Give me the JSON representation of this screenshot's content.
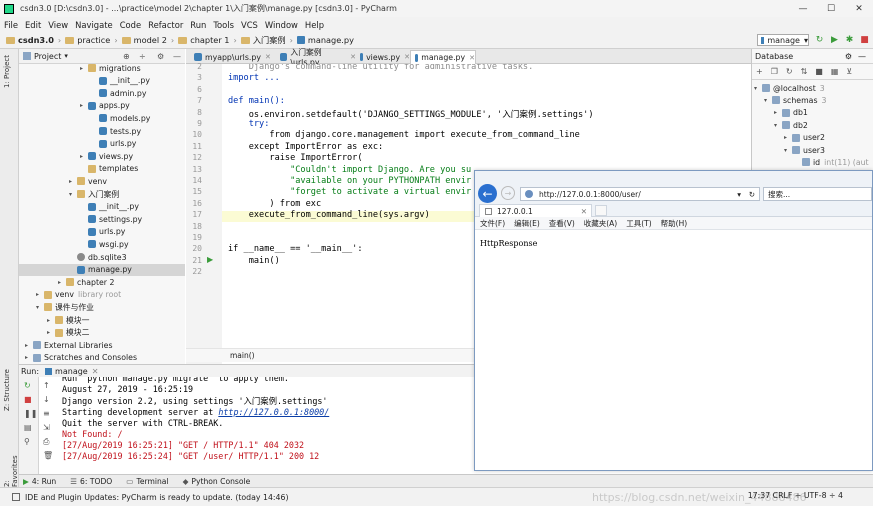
{
  "window": {
    "title": "csdn3.0 [D:\\csdn3.0] - ...\\practice\\model 2\\chapter 1\\入门案例\\manage.py [csdn3.0] - PyCharm"
  },
  "menu": [
    "File",
    "Edit",
    "View",
    "Navigate",
    "Code",
    "Refactor",
    "Run",
    "Tools",
    "VCS",
    "Window",
    "Help"
  ],
  "breadcrumb": [
    "csdn3.0",
    "practice",
    "model 2",
    "chapter 1",
    "入门案例",
    "manage.py"
  ],
  "run_config": "manage",
  "sidebar_tabs": {
    "project": "1: Project",
    "structure": "Z: Structure",
    "favorites": "2: Favorites"
  },
  "project_panel": {
    "title": "Project"
  },
  "tree": [
    {
      "label": "migrations",
      "indent": 4,
      "icon": "fold",
      "arrow": "▸"
    },
    {
      "label": "__init__.py",
      "indent": 5,
      "icon": "py",
      "arrow": ""
    },
    {
      "label": "admin.py",
      "indent": 5,
      "icon": "py",
      "arrow": ""
    },
    {
      "label": "apps.py",
      "indent": 4,
      "icon": "py",
      "arrow": "▸"
    },
    {
      "label": "models.py",
      "indent": 5,
      "icon": "py",
      "arrow": ""
    },
    {
      "label": "tests.py",
      "indent": 5,
      "icon": "py",
      "arrow": ""
    },
    {
      "label": "urls.py",
      "indent": 5,
      "icon": "py",
      "arrow": ""
    },
    {
      "label": "views.py",
      "indent": 4,
      "icon": "py",
      "arrow": "▸"
    },
    {
      "label": "templates",
      "indent": 4,
      "icon": "fold",
      "arrow": ""
    },
    {
      "label": "venv",
      "indent": 3,
      "icon": "fold",
      "arrow": "▸"
    },
    {
      "label": "入门案例",
      "indent": 3,
      "icon": "fold",
      "arrow": "▾"
    },
    {
      "label": "__init__.py",
      "indent": 4,
      "icon": "py",
      "arrow": ""
    },
    {
      "label": "settings.py",
      "indent": 4,
      "icon": "py",
      "arrow": ""
    },
    {
      "label": "urls.py",
      "indent": 4,
      "icon": "py",
      "arrow": ""
    },
    {
      "label": "wsgi.py",
      "indent": 4,
      "icon": "py",
      "arrow": ""
    },
    {
      "label": "db.sqlite3",
      "indent": 3,
      "icon": "db",
      "arrow": ""
    },
    {
      "label": "manage.py",
      "indent": 3,
      "icon": "py",
      "arrow": "",
      "selected": true
    },
    {
      "label": "chapter 2",
      "indent": 2,
      "icon": "fold",
      "arrow": "▸"
    },
    {
      "label": "venv",
      "suffix": "library root",
      "indent": 0,
      "icon": "fold",
      "arrow": "▸"
    },
    {
      "label": "课件与作业",
      "indent": 0,
      "icon": "fold",
      "arrow": "▾"
    },
    {
      "label": "模块一",
      "indent": 1,
      "icon": "fold",
      "arrow": "▸"
    },
    {
      "label": "模块二",
      "indent": 1,
      "icon": "fold",
      "arrow": "▸"
    },
    {
      "label": "External Libraries",
      "indent": -1,
      "icon": "foldb",
      "arrow": "▸"
    },
    {
      "label": "Scratches and Consoles",
      "indent": -1,
      "icon": "foldb",
      "arrow": "▸"
    }
  ],
  "editor_tabs": [
    {
      "label": "myapp\\urls.py",
      "active": false
    },
    {
      "label": "入门案例\\urls.py",
      "active": false
    },
    {
      "label": "views.py",
      "active": false
    },
    {
      "label": "manage.py",
      "active": true
    }
  ],
  "code_lines": [
    {
      "n": "2",
      "text": "    Django's command-line utility for administrative tasks.",
      "cls": "cm"
    },
    {
      "n": "3",
      "text": "import ...",
      "cls": "kw"
    },
    {
      "n": "6",
      "text": "",
      "cls": ""
    },
    {
      "n": "7",
      "text": "def main():",
      "cls": "kw"
    },
    {
      "n": "8",
      "text": "    os.environ.setdefault('DJANGO_SETTINGS_MODULE', '入门案例.settings')",
      "cls": ""
    },
    {
      "n": "9",
      "text": "    try:",
      "cls": "kw"
    },
    {
      "n": "10",
      "text": "        from django.core.management import execute_from_command_line",
      "cls": ""
    },
    {
      "n": "11",
      "text": "    except ImportError as exc:",
      "cls": ""
    },
    {
      "n": "12",
      "text": "        raise ImportError(",
      "cls": ""
    },
    {
      "n": "13",
      "text": "            \"Couldn't import Django. Are you su",
      "cls": "str"
    },
    {
      "n": "14",
      "text": "            \"available on your PYTHONPATH envir",
      "cls": "str"
    },
    {
      "n": "15",
      "text": "            \"forget to activate a virtual envir",
      "cls": "str"
    },
    {
      "n": "16",
      "text": "        ) from exc",
      "cls": ""
    },
    {
      "n": "17",
      "text": "    execute_from_command_line(sys.argv)",
      "cls": "",
      "highlight": true
    },
    {
      "n": "18",
      "text": "",
      "cls": ""
    },
    {
      "n": "19",
      "text": "",
      "cls": ""
    },
    {
      "n": "20",
      "text": "if __name__ == '__main__':",
      "cls": ""
    },
    {
      "n": "21",
      "text": "    main()",
      "cls": ""
    },
    {
      "n": "22",
      "text": "",
      "cls": ""
    }
  ],
  "editor_breadcrumb": "main()",
  "database": {
    "title": "Database",
    "items": [
      {
        "label": "@localhost",
        "count": "3",
        "indent": 0,
        "arrow": "▾"
      },
      {
        "label": "schemas",
        "count": "3",
        "indent": 1,
        "arrow": "▾"
      },
      {
        "label": "db1",
        "count": "",
        "indent": 2,
        "arrow": "▸"
      },
      {
        "label": "db2",
        "count": "",
        "indent": 2,
        "arrow": "▾"
      },
      {
        "label": "user2",
        "count": "",
        "indent": 3,
        "arrow": "▸"
      },
      {
        "label": "user3",
        "count": "",
        "indent": 3,
        "arrow": "▾"
      },
      {
        "label": "id",
        "count": "int(11) (aut",
        "indent": 4,
        "arrow": ""
      }
    ]
  },
  "run": {
    "label": "Run:",
    "tab": "manage",
    "lines": [
      {
        "text": "Run 'python manage.py migrate' to apply them.",
        "cls": ""
      },
      {
        "text": "August 27, 2019 - 16:25:19",
        "cls": ""
      },
      {
        "text": "Django version 2.2, using settings '入门案例.settings'",
        "cls": ""
      },
      {
        "text": "Starting development server at ",
        "link": "http://127.0.0.1:8000/",
        "cls": ""
      },
      {
        "text": "Quit the server with CTRL-BREAK.",
        "cls": ""
      },
      {
        "text": "Not Found: /",
        "cls": "red"
      },
      {
        "text": "[27/Aug/2019 16:25:21] \"GET / HTTP/1.1\" 404 2032",
        "cls": "red"
      },
      {
        "text": "[27/Aug/2019 16:25:24] \"GET /user/ HTTP/1.1\" 200 12",
        "cls": "red"
      }
    ]
  },
  "bottom_tabs": [
    "4: Run",
    "6: TODO",
    "Terminal",
    "Python Console"
  ],
  "status": {
    "message": "IDE and Plugin Updates: PyCharm is ready to update. (today 14:46)",
    "right": "17:37  CRLF ÷  UTF-8 ÷  4",
    "watermark": "https://blog.csdn.net/weixin_44888486"
  },
  "browser": {
    "url": "http://127.0.0.1:8000/user/",
    "search_placeholder": "搜索...",
    "tab_title": "127.0.0.1",
    "menu": [
      "文件(F)",
      "编辑(E)",
      "查看(V)",
      "收藏夹(A)",
      "工具(T)",
      "帮助(H)"
    ],
    "body": "HttpResponse"
  }
}
